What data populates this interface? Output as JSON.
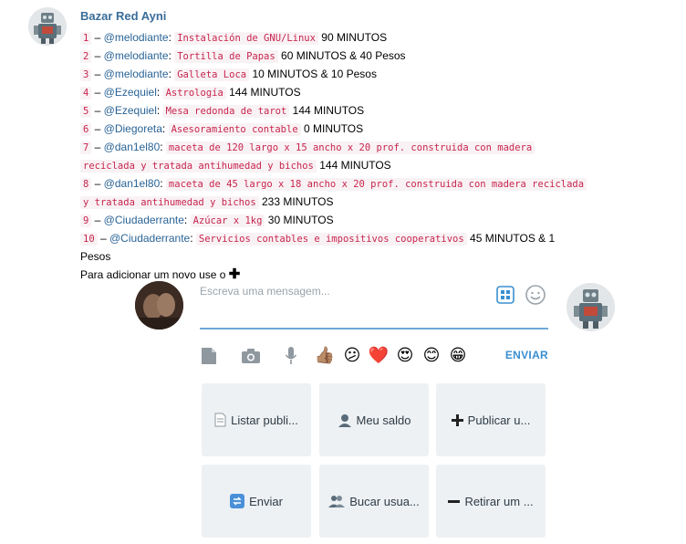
{
  "message": {
    "sender": "Bazar Red Ayni",
    "lines": [
      {
        "num": "1",
        "user": "@melodiante",
        "item": "Instalación de GNU/Linux",
        "value": "90 MINUTOS"
      },
      {
        "num": "2",
        "user": "@melodiante",
        "item": "Tortilla de Papas",
        "value": "60 MINUTOS & 40 Pesos"
      },
      {
        "num": "3",
        "user": "@melodiante",
        "item": "Galleta Loca",
        "value": "10 MINUTOS & 10 Pesos"
      },
      {
        "num": "4",
        "user": "@Ezequiel",
        "item": "Astrología",
        "value": "144 MINUTOS"
      },
      {
        "num": "5",
        "user": "@Ezequiel",
        "item": "Mesa redonda de tarot",
        "value": "144 MINUTOS"
      },
      {
        "num": "6",
        "user": "@Diegoreta",
        "item": "Asesoramiento contable",
        "value": "0 MINUTOS"
      },
      {
        "num": "7",
        "user": "@dan1el80",
        "item_a": "maceta de 120 largo x 15 ancho x 20 prof. construida con madera",
        "item_b": "reciclada y tratada antihumedad y bichos",
        "value": "144 MINUTOS"
      },
      {
        "num": "8",
        "user": "@dan1el80",
        "item_a": "maceta de 45 largo x 18 ancho x 20 prof. construida con madera reciclada",
        "item_b": "y tratada antihumedad y bichos",
        "value": "233 MINUTOS"
      },
      {
        "num": "9",
        "user": "@Ciudaderrante",
        "item": "Azúcar x 1kg",
        "value": "30 MINUTOS"
      },
      {
        "num": "10",
        "user": "@Ciudaderrante",
        "item": "Servicios contables e impositivos cooperativos",
        "value_a": "45 MINUTOS & 1",
        "value_b": "Pesos"
      }
    ],
    "footer": "Para adicionar um novo use o",
    "footer_icon": "plus-icon"
  },
  "composer": {
    "placeholder": "Escreva uma mensagem...",
    "send_label": "ENVIAR"
  },
  "toolbar": {
    "emojis": [
      "👍🏽",
      "😕",
      "❤️",
      "😍",
      "😊",
      "😁"
    ]
  },
  "keyboard": {
    "buttons": [
      {
        "label": "Listar publi...",
        "icon": "page-icon"
      },
      {
        "label": "Meu saldo",
        "icon": "bust-icon"
      },
      {
        "label": "Publicar u...",
        "icon": "plus-icon"
      },
      {
        "label": "Enviar",
        "icon": "arrows-icon"
      },
      {
        "label": "Bucar usua...",
        "icon": "busts-icon"
      },
      {
        "label": "Retirar um ...",
        "icon": "minus-icon"
      }
    ]
  },
  "colors": {
    "sender": "#3a6d99",
    "code_text": "#c7254e",
    "code_bg": "#f9f2f4",
    "send": "#3a8fd1",
    "composer_line": "#6fa8d6",
    "key_bg": "#edf1f4"
  }
}
